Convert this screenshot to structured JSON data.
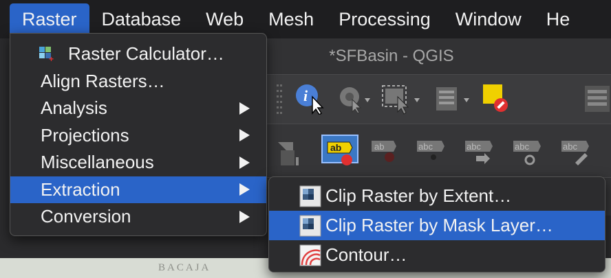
{
  "menubar": {
    "items": [
      {
        "label": "Raster"
      },
      {
        "label": "Database"
      },
      {
        "label": "Web"
      },
      {
        "label": "Mesh"
      },
      {
        "label": "Processing"
      },
      {
        "label": "Window"
      },
      {
        "label": "He"
      }
    ]
  },
  "window": {
    "title": "*SFBasin - QGIS"
  },
  "map": {
    "label": "BACAJA"
  },
  "raster_menu": {
    "items": [
      {
        "label": "Raster Calculator…",
        "icon": "raster-calculator-icon"
      },
      {
        "label": "Align Rasters…"
      },
      {
        "label": "Analysis",
        "submenu": true
      },
      {
        "label": "Projections",
        "submenu": true
      },
      {
        "label": "Miscellaneous",
        "submenu": true
      },
      {
        "label": "Extraction",
        "submenu": true
      },
      {
        "label": "Conversion",
        "submenu": true
      }
    ]
  },
  "extraction_submenu": {
    "items": [
      {
        "label": "Clip Raster by Extent…",
        "icon": "clip-extent-icon"
      },
      {
        "label": "Clip Raster by Mask Layer…",
        "icon": "clip-mask-icon"
      },
      {
        "label": "Contour…",
        "icon": "contour-icon"
      }
    ]
  },
  "colors": {
    "accent": "#2a64c8",
    "menu_bg": "#2c2c2e",
    "text": "#f2f2f2"
  }
}
